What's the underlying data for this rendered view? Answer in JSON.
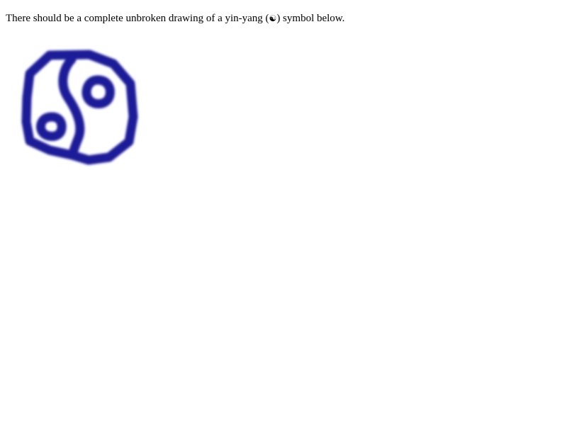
{
  "instruction": {
    "text_before": "There should be a complete unbroken drawing of a yin-yang (",
    "symbol": "☯",
    "text_after": ") symbol below."
  },
  "drawing": {
    "icon": "yin-yang-icon",
    "stroke_color": "#1a1a99"
  }
}
